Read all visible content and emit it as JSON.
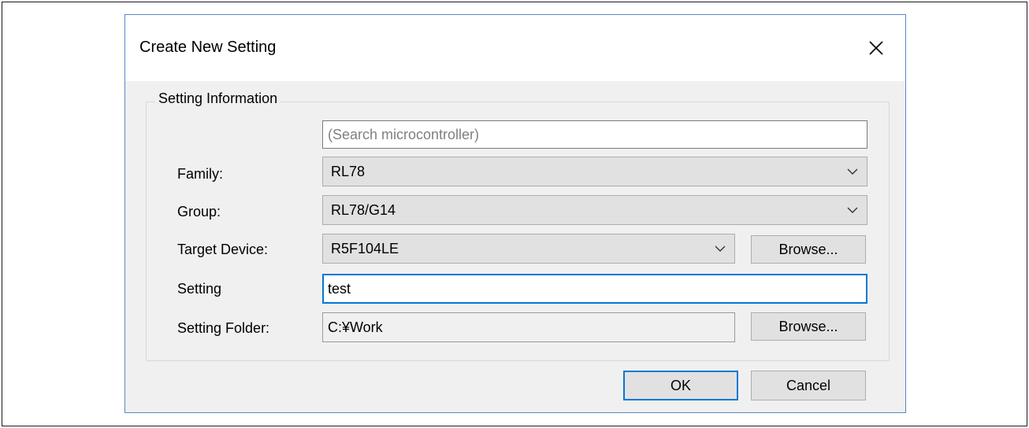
{
  "dialog": {
    "title": "Create New Setting",
    "close_icon": "close-icon"
  },
  "group": {
    "legend": "Setting Information"
  },
  "search": {
    "placeholder": "(Search microcontroller)"
  },
  "family": {
    "label": "Family:",
    "value": "RL78"
  },
  "device_group": {
    "label": "Group:",
    "value": "RL78/G14"
  },
  "target_device": {
    "label": "Target Device:",
    "value": "R5F104LE",
    "browse_label": "Browse..."
  },
  "setting": {
    "label": "Setting",
    "value": "test"
  },
  "setting_folder": {
    "label": "Setting Folder:",
    "value": "C:¥Work",
    "browse_label": "Browse..."
  },
  "buttons": {
    "ok_label": "OK",
    "cancel_label": "Cancel"
  },
  "colors": {
    "focus": "#0078d7",
    "dialog_border": "#5a87c6",
    "dialog_background": "#f0f0f0"
  }
}
